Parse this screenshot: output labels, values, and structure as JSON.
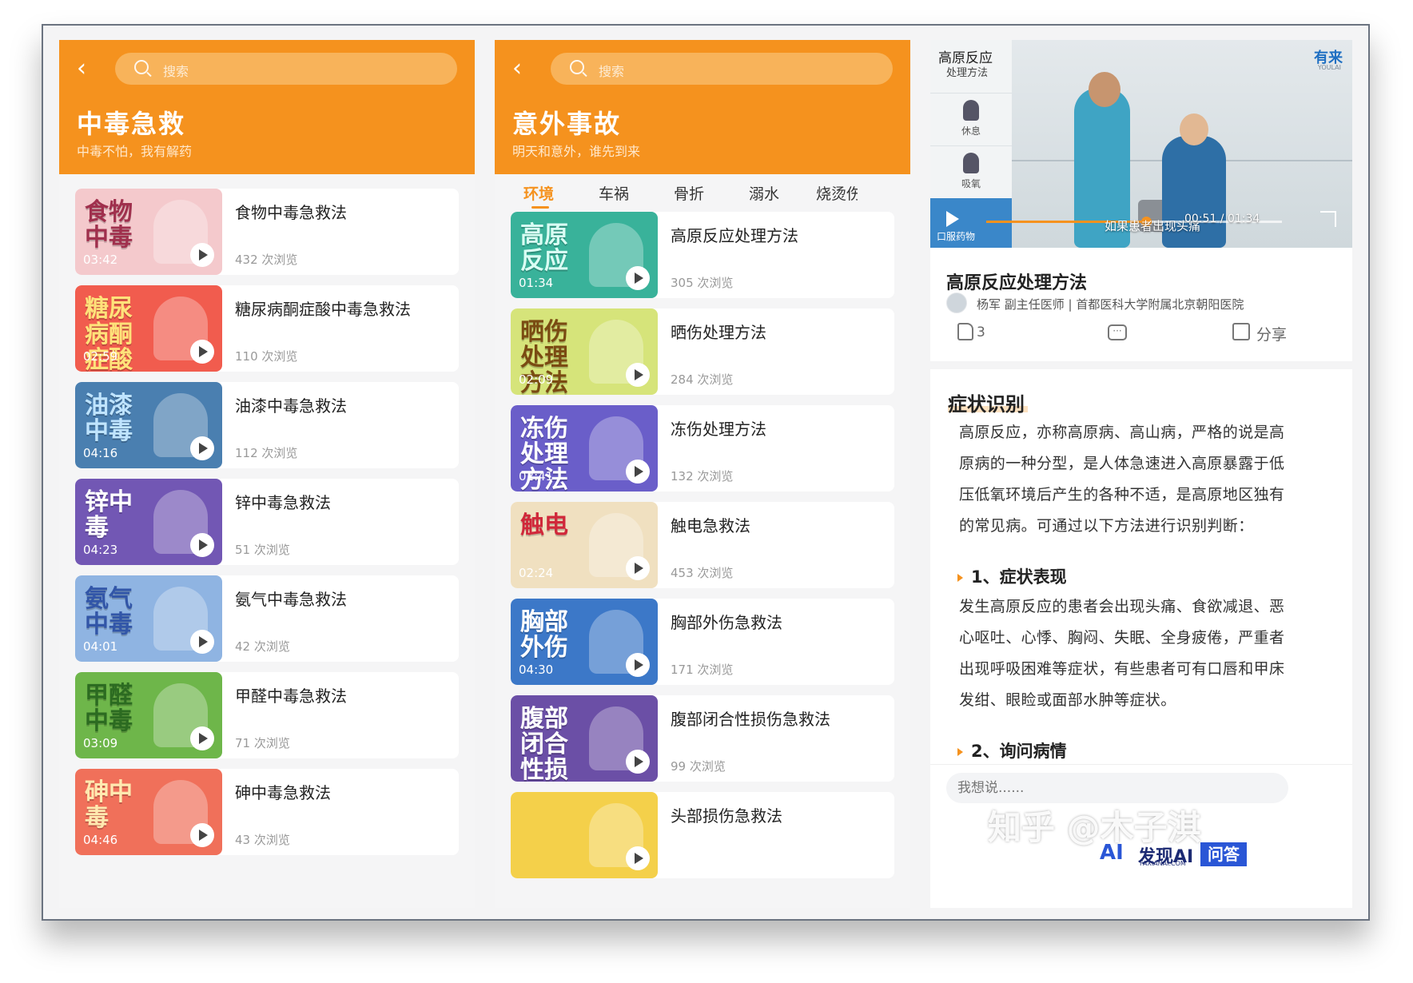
{
  "poison_page": {
    "search_placeholder": "搜索",
    "title": "中毒急救",
    "subtitle": "中毒不怕，我有解药",
    "items": [
      {
        "thumb_text": "食物中毒",
        "thumb_color": "#f4c9cc",
        "text_color": "#a0304d",
        "duration": "03:42",
        "title": "食物中毒急救法",
        "views": "432 次浏览"
      },
      {
        "thumb_text": "糖尿病酮症酸中毒",
        "thumb_color": "#f15c4e",
        "text_color": "#ffe27a",
        "duration": "02:59",
        "title": "糖尿病酮症酸中毒急救法",
        "views": "110 次浏览"
      },
      {
        "thumb_text": "油漆中毒",
        "thumb_color": "#4a7fb0",
        "text_color": "#bfe4ff",
        "duration": "04:16",
        "title": "油漆中毒急救法",
        "views": "112 次浏览"
      },
      {
        "thumb_text": "锌中毒",
        "thumb_color": "#7257b4",
        "text_color": "#ffffff",
        "duration": "04:23",
        "title": "锌中毒急救法",
        "views": "51 次浏览"
      },
      {
        "thumb_text": "氨气中毒",
        "thumb_color": "#8fb4e2",
        "text_color": "#3256a8",
        "duration": "04:01",
        "title": "氨气中毒急救法",
        "views": "42 次浏览"
      },
      {
        "thumb_text": "甲醛中毒",
        "thumb_color": "#6eb64a",
        "text_color": "#2c6b21",
        "duration": "03:09",
        "title": "甲醛中毒急救法",
        "views": "71 次浏览"
      },
      {
        "thumb_text": "砷中毒",
        "thumb_color": "#f0705a",
        "text_color": "#ffe9b0",
        "duration": "04:46",
        "title": "砷中毒急救法",
        "views": "43 次浏览"
      }
    ]
  },
  "accident_page": {
    "search_placeholder": "搜索",
    "title": "意外事故",
    "subtitle": "明天和意外，谁先到来",
    "tabs": [
      "环境",
      "车祸",
      "骨折",
      "溺水",
      "烧烫伤"
    ],
    "items": [
      {
        "thumb_text": "高原反应",
        "thumb_color": "#39b29a",
        "text_color": "#d9fff4",
        "duration": "01:34",
        "title": "高原反应处理方法",
        "views": "305 次浏览"
      },
      {
        "thumb_text": "晒伤处理方法",
        "thumb_color": "#d6e47a",
        "text_color": "#7a4b12",
        "duration": "02:09",
        "title": "晒伤处理方法",
        "views": "284 次浏览"
      },
      {
        "thumb_text": "冻伤处理方法",
        "thumb_color": "#6a5ec9",
        "text_color": "#ffffff",
        "duration": "02:41",
        "title": "冻伤处理方法",
        "views": "132 次浏览"
      },
      {
        "thumb_text": "触电",
        "thumb_color": "#f0e0c0",
        "text_color": "#d0283a",
        "duration": "02:24",
        "title": "触电急救法",
        "views": "453 次浏览"
      },
      {
        "thumb_text": "胸部外伤",
        "thumb_color": "#3c78c8",
        "text_color": "#ffffff",
        "duration": "04:30",
        "title": "胸部外伤急救法",
        "views": "171 次浏览"
      },
      {
        "thumb_text": "腹部闭合性损伤",
        "thumb_color": "#6b4fa6",
        "text_color": "#ffffff",
        "duration": "",
        "title": "腹部闭合性损伤急救法",
        "views": "99 次浏览"
      },
      {
        "thumb_text": "",
        "thumb_color": "#f4d04a",
        "text_color": "#ffffff",
        "duration": "",
        "title": "头部损伤急救法",
        "views": ""
      }
    ]
  },
  "detail_page": {
    "video": {
      "side_title": "高原反应",
      "side_subtitle": "处理方法",
      "side_items": [
        "休息",
        "吸氧"
      ],
      "side_active": "口服药物",
      "logo": "有来",
      "logo_sub": "YOULAI",
      "caption": "如果患者出现头痛",
      "time": "00:51 / 01:34",
      "progress": 0.54
    },
    "title": "高原反应处理方法",
    "author": "杨军  副主任医师  |  首都医科大学附属北京朝阳医院",
    "likes": "3",
    "share_label": "分享",
    "section_title": "症状识别",
    "para1": "高原反应，亦称高原病、高山病，严格的说是高原病的一种分型，是人体急速进入高原暴露于低压低氧环境后产生的各种不适，是高原地区独有的常见病。可通过以下方法进行识别判断：",
    "sub1": "1、症状表现",
    "para2": "发生高原反应的患者会出现头痛、食欲减退、恶心呕吐、心悸、胸闷、失眠、全身疲倦，严重者出现呼吸困难等症状，有些患者可有口唇和甲床发绀、眼睑或面部水肿等症状。",
    "sub2": "2、询问病情",
    "comment_placeholder": "我想说......"
  },
  "watermark": {
    "zhihu": "知乎 @木子淇",
    "brand_logo": "AI",
    "brand": "发现AI",
    "brand_sub": "FAXIANAI.COM",
    "qa": "问答"
  }
}
